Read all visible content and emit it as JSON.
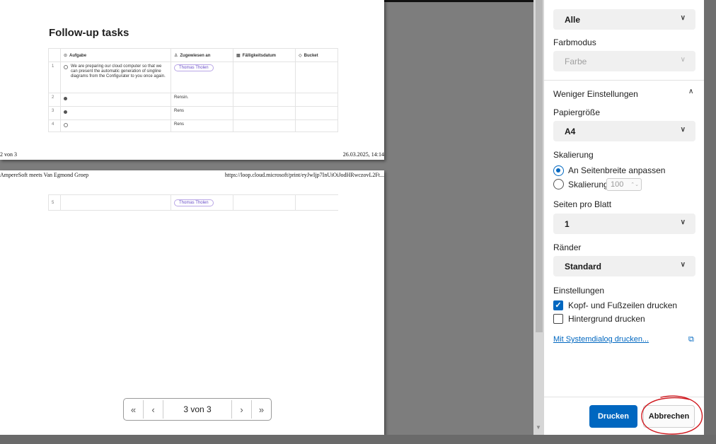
{
  "preview": {
    "page1": {
      "title": "Follow-up tasks",
      "headers": [
        "Aufgabe",
        "Zugewiesen an",
        "Fälligkeitsdatum",
        "Bucket"
      ],
      "header_icons": [
        "circle-check-icon",
        "person-icon",
        "calendar-icon",
        "tag-icon"
      ],
      "rows": [
        {
          "num": "1",
          "status": "open",
          "task": "We are preparing our cloud computer so that we can present the automatic generation of singline diagrams from the Configurater to you once again.",
          "assignee": "Thomas Tholen"
        },
        {
          "num": "2",
          "status": "done",
          "task": "",
          "assignee": "Rensin."
        },
        {
          "num": "3",
          "status": "done",
          "task": "",
          "assignee": "Rens"
        },
        {
          "num": "4",
          "status": "open",
          "task": "",
          "assignee": "Rens"
        }
      ],
      "footer_left": "2 von 3",
      "footer_right": "26.03.2025, 14:14"
    },
    "page2": {
      "header_left": "AmpereSoft meets Van Egmond Groep",
      "header_right": "https://loop.cloud.microsoft/print/eyJwIjp7InUiOiJodHRwczovL2Ft...",
      "rows": [
        {
          "num": "5",
          "assignee": "Thomas Tholen"
        }
      ]
    },
    "pager": {
      "first": "«",
      "prev": "‹",
      "info": "3 von 3",
      "next": "›",
      "last": "»"
    }
  },
  "panel": {
    "pages_value": "Alle",
    "color_label": "Farbmodus",
    "color_value": "Farbe",
    "less_settings": "Weniger Einstellungen",
    "paper_label": "Papiergröße",
    "paper_value": "A4",
    "scale_label": "Skalierung",
    "scale_fit": "An Seitenbreite anpassen",
    "scale_custom": "Skalierung",
    "scale_value": "100",
    "pps_label": "Seiten pro Blatt",
    "pps_value": "1",
    "margins_label": "Ränder",
    "margins_value": "Standard",
    "settings_label": "Einstellungen",
    "opt_headers": "Kopf- und Fußzeilen drucken",
    "opt_background": "Hintergrund drucken",
    "system_dialog": "Mit Systemdialog drucken...",
    "print_button": "Drucken",
    "cancel_button": "Abbrechen"
  },
  "colors": {
    "accent": "#0067c0",
    "annotation": "#d0181e",
    "assignee_pill": "#6a4fc8"
  }
}
